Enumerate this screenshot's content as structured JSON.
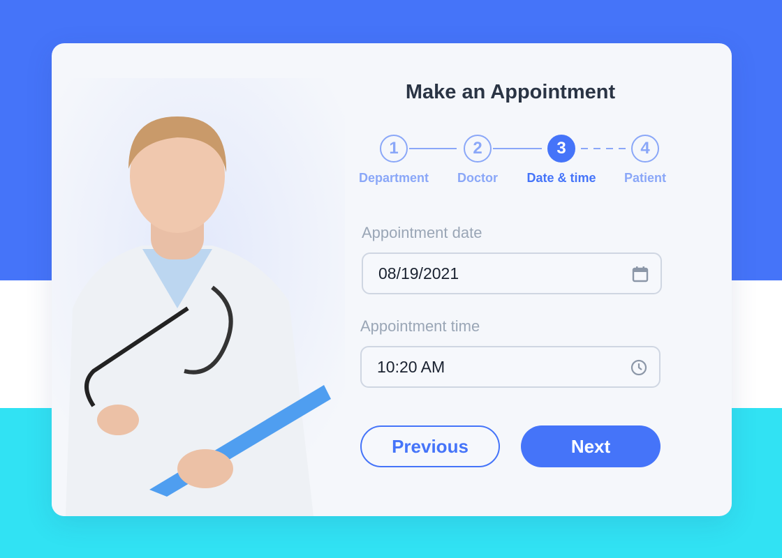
{
  "colors": {
    "primary": "#4574f9",
    "accent_bg": "#31e2f3",
    "step_inactive": "#8aa7f8"
  },
  "title": "Make an Appointment",
  "steps": [
    {
      "number": "1",
      "label": "Department",
      "state": "completed"
    },
    {
      "number": "2",
      "label": "Doctor",
      "state": "completed"
    },
    {
      "number": "3",
      "label": "Date & time",
      "state": "active"
    },
    {
      "number": "4",
      "label": "Patient",
      "state": "upcoming"
    }
  ],
  "date": {
    "label": "Appointment date",
    "value": "08/19/2021",
    "icon": "calendar-icon"
  },
  "time": {
    "label": "Appointment time",
    "value": "10:20 AM",
    "icon": "clock-icon"
  },
  "buttons": {
    "previous": "Previous",
    "next": "Next"
  }
}
